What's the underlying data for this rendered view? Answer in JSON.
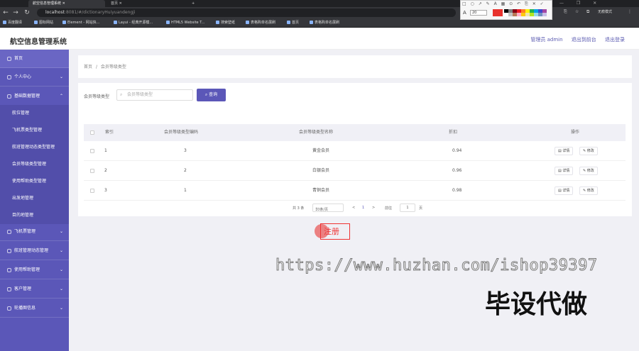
{
  "browser": {
    "tabs": [
      {
        "label": "航空信息管理系统"
      },
      {
        "label": "首页"
      }
    ],
    "url_host": "localhost",
    "url_rest": ":8081/#/dictionaryHuiyuandengji",
    "bookmarks": [
      "百度翻译",
      "图标网站",
      "Element - 网站快...",
      "Layui - 经典开源模...",
      "HTML5 Website T...",
      "搜索壁纸",
      "表格购单名展刷",
      "首页",
      "表格购单名展刷"
    ],
    "annot_size": "20",
    "annot_font_icon": "A",
    "annot_tools_icons": "□ ○ ↗ ✎ A ▦ ⊙ ↶ ⎘ ✕ ✓",
    "user_label": "无痕模式",
    "colors": [
      "#000000",
      "#7f7f7f",
      "#880015",
      "#ed1c24",
      "#ff7f27",
      "#fff200",
      "#22b14c",
      "#00a2e8",
      "#3f48cc",
      "#a349a4",
      "#ffffff",
      "#c3c3c3",
      "#b97a57",
      "#ffaec9",
      "#ffc90e",
      "#efe4b0",
      "#b5e61d",
      "#99d9ea",
      "#7092be",
      "#c8bfe7"
    ],
    "current_color": "#e8322d"
  },
  "app": {
    "title": "航空信息管理系统",
    "header_links": [
      "管理员 admin",
      "退出到前台",
      "退出登录"
    ]
  },
  "sidebar": {
    "home": "首页",
    "personal": "个人中心",
    "basic": "基础数据管理",
    "basic_sub": [
      "航位管理",
      "飞机票类型管理",
      "航班管理动态类型管理",
      "会员等级类型管理",
      "使用帮助类型管理",
      "出发地管理",
      "目的地管理"
    ],
    "groups": [
      "飞机票管理",
      "航班管理动态管理",
      "使用帮助管理",
      "客户管理",
      "轮播图信息"
    ]
  },
  "breadcrumb": {
    "home": "首页",
    "sep": "/",
    "current": "会员等级类型"
  },
  "filter": {
    "label": "会员等级类型",
    "placeholder": "会员等级类型",
    "search_label": "查询"
  },
  "table": {
    "headers": [
      "索引",
      "会员等级类型编码",
      "会员等级类型名称",
      "折扣",
      "操作"
    ],
    "rows": [
      {
        "index": "1",
        "code": "3",
        "name": "黄金会员",
        "discount": "0.94"
      },
      {
        "index": "2",
        "code": "2",
        "name": "白银会员",
        "discount": "0.96"
      },
      {
        "index": "3",
        "code": "1",
        "name": "青铜会员",
        "discount": "0.98"
      }
    ],
    "detail_label": "详情",
    "edit_label": "修改"
  },
  "pager": {
    "total": "共 3 条",
    "page_size": "10条/页",
    "prev": "<",
    "current": "1",
    "next": ">",
    "goto": "前往",
    "goto_value": "1",
    "page_unit": "页"
  },
  "overlay": {
    "register_text": "注册",
    "watermark_url": "https://www.huzhan.com/ishop39397",
    "watermark_text": "毕设代做"
  }
}
